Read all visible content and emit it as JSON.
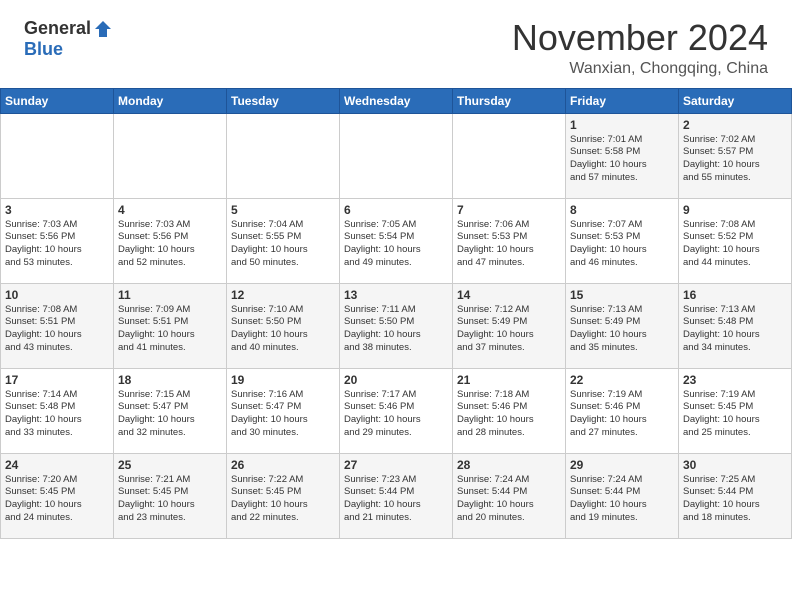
{
  "header": {
    "logo_general": "General",
    "logo_blue": "Blue",
    "month_title": "November 2024",
    "subtitle": "Wanxian, Chongqing, China"
  },
  "weekdays": [
    "Sunday",
    "Monday",
    "Tuesday",
    "Wednesday",
    "Thursday",
    "Friday",
    "Saturday"
  ],
  "weeks": [
    [
      {
        "day": "",
        "info": ""
      },
      {
        "day": "",
        "info": ""
      },
      {
        "day": "",
        "info": ""
      },
      {
        "day": "",
        "info": ""
      },
      {
        "day": "",
        "info": ""
      },
      {
        "day": "1",
        "info": "Sunrise: 7:01 AM\nSunset: 5:58 PM\nDaylight: 10 hours\nand 57 minutes."
      },
      {
        "day": "2",
        "info": "Sunrise: 7:02 AM\nSunset: 5:57 PM\nDaylight: 10 hours\nand 55 minutes."
      }
    ],
    [
      {
        "day": "3",
        "info": "Sunrise: 7:03 AM\nSunset: 5:56 PM\nDaylight: 10 hours\nand 53 minutes."
      },
      {
        "day": "4",
        "info": "Sunrise: 7:03 AM\nSunset: 5:56 PM\nDaylight: 10 hours\nand 52 minutes."
      },
      {
        "day": "5",
        "info": "Sunrise: 7:04 AM\nSunset: 5:55 PM\nDaylight: 10 hours\nand 50 minutes."
      },
      {
        "day": "6",
        "info": "Sunrise: 7:05 AM\nSunset: 5:54 PM\nDaylight: 10 hours\nand 49 minutes."
      },
      {
        "day": "7",
        "info": "Sunrise: 7:06 AM\nSunset: 5:53 PM\nDaylight: 10 hours\nand 47 minutes."
      },
      {
        "day": "8",
        "info": "Sunrise: 7:07 AM\nSunset: 5:53 PM\nDaylight: 10 hours\nand 46 minutes."
      },
      {
        "day": "9",
        "info": "Sunrise: 7:08 AM\nSunset: 5:52 PM\nDaylight: 10 hours\nand 44 minutes."
      }
    ],
    [
      {
        "day": "10",
        "info": "Sunrise: 7:08 AM\nSunset: 5:51 PM\nDaylight: 10 hours\nand 43 minutes."
      },
      {
        "day": "11",
        "info": "Sunrise: 7:09 AM\nSunset: 5:51 PM\nDaylight: 10 hours\nand 41 minutes."
      },
      {
        "day": "12",
        "info": "Sunrise: 7:10 AM\nSunset: 5:50 PM\nDaylight: 10 hours\nand 40 minutes."
      },
      {
        "day": "13",
        "info": "Sunrise: 7:11 AM\nSunset: 5:50 PM\nDaylight: 10 hours\nand 38 minutes."
      },
      {
        "day": "14",
        "info": "Sunrise: 7:12 AM\nSunset: 5:49 PM\nDaylight: 10 hours\nand 37 minutes."
      },
      {
        "day": "15",
        "info": "Sunrise: 7:13 AM\nSunset: 5:49 PM\nDaylight: 10 hours\nand 35 minutes."
      },
      {
        "day": "16",
        "info": "Sunrise: 7:13 AM\nSunset: 5:48 PM\nDaylight: 10 hours\nand 34 minutes."
      }
    ],
    [
      {
        "day": "17",
        "info": "Sunrise: 7:14 AM\nSunset: 5:48 PM\nDaylight: 10 hours\nand 33 minutes."
      },
      {
        "day": "18",
        "info": "Sunrise: 7:15 AM\nSunset: 5:47 PM\nDaylight: 10 hours\nand 32 minutes."
      },
      {
        "day": "19",
        "info": "Sunrise: 7:16 AM\nSunset: 5:47 PM\nDaylight: 10 hours\nand 30 minutes."
      },
      {
        "day": "20",
        "info": "Sunrise: 7:17 AM\nSunset: 5:46 PM\nDaylight: 10 hours\nand 29 minutes."
      },
      {
        "day": "21",
        "info": "Sunrise: 7:18 AM\nSunset: 5:46 PM\nDaylight: 10 hours\nand 28 minutes."
      },
      {
        "day": "22",
        "info": "Sunrise: 7:19 AM\nSunset: 5:46 PM\nDaylight: 10 hours\nand 27 minutes."
      },
      {
        "day": "23",
        "info": "Sunrise: 7:19 AM\nSunset: 5:45 PM\nDaylight: 10 hours\nand 25 minutes."
      }
    ],
    [
      {
        "day": "24",
        "info": "Sunrise: 7:20 AM\nSunset: 5:45 PM\nDaylight: 10 hours\nand 24 minutes."
      },
      {
        "day": "25",
        "info": "Sunrise: 7:21 AM\nSunset: 5:45 PM\nDaylight: 10 hours\nand 23 minutes."
      },
      {
        "day": "26",
        "info": "Sunrise: 7:22 AM\nSunset: 5:45 PM\nDaylight: 10 hours\nand 22 minutes."
      },
      {
        "day": "27",
        "info": "Sunrise: 7:23 AM\nSunset: 5:44 PM\nDaylight: 10 hours\nand 21 minutes."
      },
      {
        "day": "28",
        "info": "Sunrise: 7:24 AM\nSunset: 5:44 PM\nDaylight: 10 hours\nand 20 minutes."
      },
      {
        "day": "29",
        "info": "Sunrise: 7:24 AM\nSunset: 5:44 PM\nDaylight: 10 hours\nand 19 minutes."
      },
      {
        "day": "30",
        "info": "Sunrise: 7:25 AM\nSunset: 5:44 PM\nDaylight: 10 hours\nand 18 minutes."
      }
    ]
  ]
}
